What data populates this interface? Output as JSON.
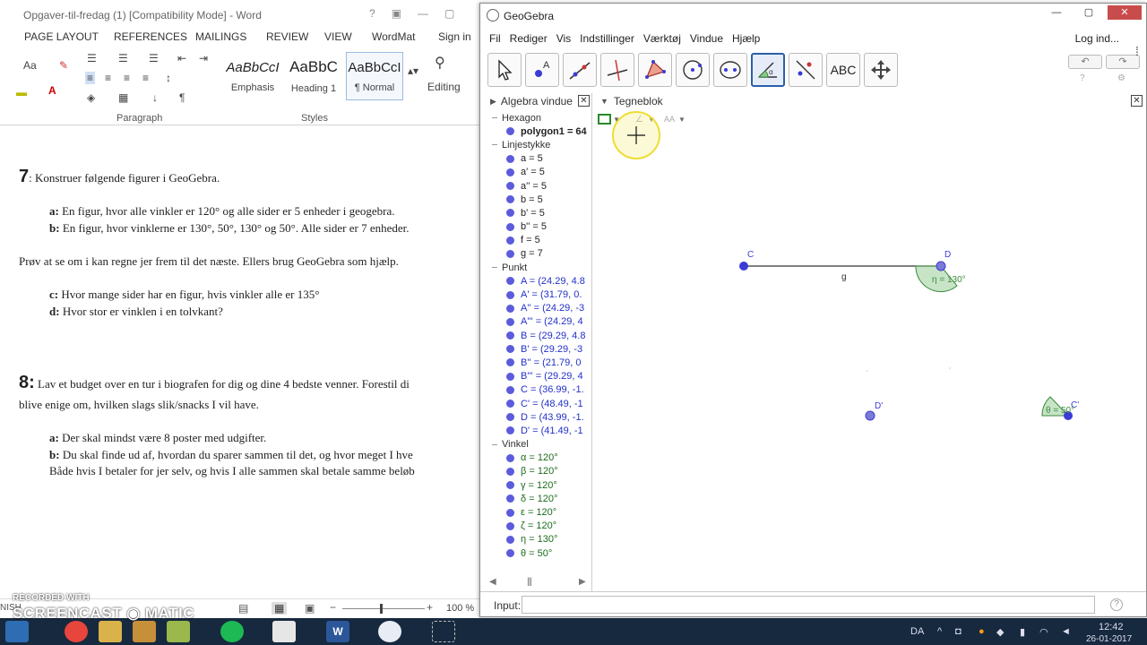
{
  "word": {
    "title": "Opgaver-til-fredag (1) [Compatibility Mode] - Word",
    "tabs": [
      "PAGE LAYOUT",
      "REFERENCES",
      "MAILINGS",
      "REVIEW",
      "VIEW",
      "WordMat",
      "Sign in"
    ],
    "styles": [
      {
        "sample": "AaBbCcI",
        "name": "Emphasis"
      },
      {
        "sample": "AaBbC",
        "name": "Heading 1"
      },
      {
        "sample": "AaBbCcI",
        "name": "¶ Normal"
      }
    ],
    "groups": {
      "paragraph": "Paragraph",
      "styles": "Styles",
      "editing": "Editing",
      "font_size": "Aa"
    },
    "doc": {
      "q7_num": "7",
      "q7_text": ": Konstruer følgende figurer i GeoGebra.",
      "q7a_label": "a:",
      "q7a_text": " En figur, hvor alle vinkler er 120° og alle sider er 5 enheder i geogebra.",
      "q7b_label": "b:",
      "q7b_text": " En figur, hvor vinklerne er 130°, 50°, 130° og 50°. Alle sider er 7 enheder.",
      "try_text": "Prøv at se om i kan regne jer frem til det næste. Ellers brug GeoGebra som hjælp.",
      "q7c_label": "c:",
      "q7c_text": " Hvor mange sider har en figur, hvis vinkler alle er 135°",
      "q7d_label": "d:",
      "q7d_text": " Hvor stor er vinklen i en tolvkant?",
      "q8_num": "8:",
      "q8_text": " Lav et budget over en tur i biografen for dig og dine 4 bedste venner. Forestil di",
      "q8_text2": "blive enige om, hvilken slags slik/snacks I vil have.",
      "q8a_label": "a:",
      "q8a_text": " Der skal mindst være 8 poster med udgifter.",
      "q8b_label": "b:",
      "q8b_text": " Du skal finde ud af, hvordan du sparer sammen til det, og hvor meget I hve",
      "q8b_text2": "Både hvis I betaler for jer selv, og hvis I alle sammen skal betale samme beløb"
    },
    "status": {
      "zoom": "100 %",
      "lang": "NISH"
    }
  },
  "watermark": {
    "line1": "RECORDED WITH",
    "line2": "SCREENCAST",
    "line3": "MATIC"
  },
  "geogebra": {
    "title": "GeoGebra",
    "menu": [
      "Fil",
      "Rediger",
      "Vis",
      "Indstillinger",
      "Værktøj",
      "Vindue",
      "Hjælp"
    ],
    "login": "Log ind...",
    "algebra_title": "Algebra vindue",
    "graphics_title": "Tegneblok",
    "algebra": [
      {
        "kind": "cat",
        "text": "Hexagon"
      },
      {
        "kind": "item",
        "text": "polygon1 = 64",
        "style": "bold"
      },
      {
        "kind": "cat",
        "text": "Linjestykke"
      },
      {
        "kind": "item",
        "text": "a = 5"
      },
      {
        "kind": "item",
        "text": "a' = 5"
      },
      {
        "kind": "item",
        "text": "a'' = 5"
      },
      {
        "kind": "item",
        "text": "b = 5"
      },
      {
        "kind": "item",
        "text": "b' = 5"
      },
      {
        "kind": "item",
        "text": "b'' = 5"
      },
      {
        "kind": "item",
        "text": "f = 5"
      },
      {
        "kind": "item",
        "text": "g = 7"
      },
      {
        "kind": "cat",
        "text": "Punkt"
      },
      {
        "kind": "item",
        "text": "A = (24.29, 4.8",
        "style": "point"
      },
      {
        "kind": "item",
        "text": "A' = (31.79, 0.",
        "style": "point"
      },
      {
        "kind": "item",
        "text": "A'' = (24.29, -3",
        "style": "point"
      },
      {
        "kind": "item",
        "text": "A''' = (24.29, 4",
        "style": "point"
      },
      {
        "kind": "item",
        "text": "B = (29.29, 4.8",
        "style": "point"
      },
      {
        "kind": "item",
        "text": "B' = (29.29, -3",
        "style": "point"
      },
      {
        "kind": "item",
        "text": "B'' = (21.79, 0",
        "style": "point"
      },
      {
        "kind": "item",
        "text": "B''' = (29.29, 4",
        "style": "point"
      },
      {
        "kind": "item",
        "text": "C = (36.99, -1.",
        "style": "point"
      },
      {
        "kind": "item",
        "text": "C' = (48.49, -1",
        "style": "point"
      },
      {
        "kind": "item",
        "text": "D = (43.99, -1.",
        "style": "point"
      },
      {
        "kind": "item",
        "text": "D' = (41.49, -1",
        "style": "point"
      },
      {
        "kind": "cat",
        "text": "Vinkel"
      },
      {
        "kind": "item",
        "text": "α = 120°",
        "style": "angle"
      },
      {
        "kind": "item",
        "text": "β = 120°",
        "style": "angle"
      },
      {
        "kind": "item",
        "text": "γ = 120°",
        "style": "angle"
      },
      {
        "kind": "item",
        "text": "δ = 120°",
        "style": "angle"
      },
      {
        "kind": "item",
        "text": "ε = 120°",
        "style": "angle"
      },
      {
        "kind": "item",
        "text": "ζ = 120°",
        "style": "angle"
      },
      {
        "kind": "item",
        "text": "η = 130°",
        "style": "angle"
      },
      {
        "kind": "item",
        "text": "θ = 50°",
        "style": "angle"
      }
    ],
    "canvas_labels": {
      "C": "C",
      "D": "D",
      "g": "g",
      "eta": "η = 130°",
      "Dp": "D'",
      "Cp": "C'",
      "theta": "θ = 50°"
    },
    "tool_text": "ABC",
    "input_label": "Input:",
    "input_value": "",
    "colors": {
      "point": "#3b3bd6",
      "angle": "#3a8a3a",
      "cursor_highlight": "#f5f08a",
      "close": "#c94c4c"
    }
  },
  "taskbar": {
    "lang": "DA",
    "time": "12:42",
    "date": "26-01-2017"
  }
}
